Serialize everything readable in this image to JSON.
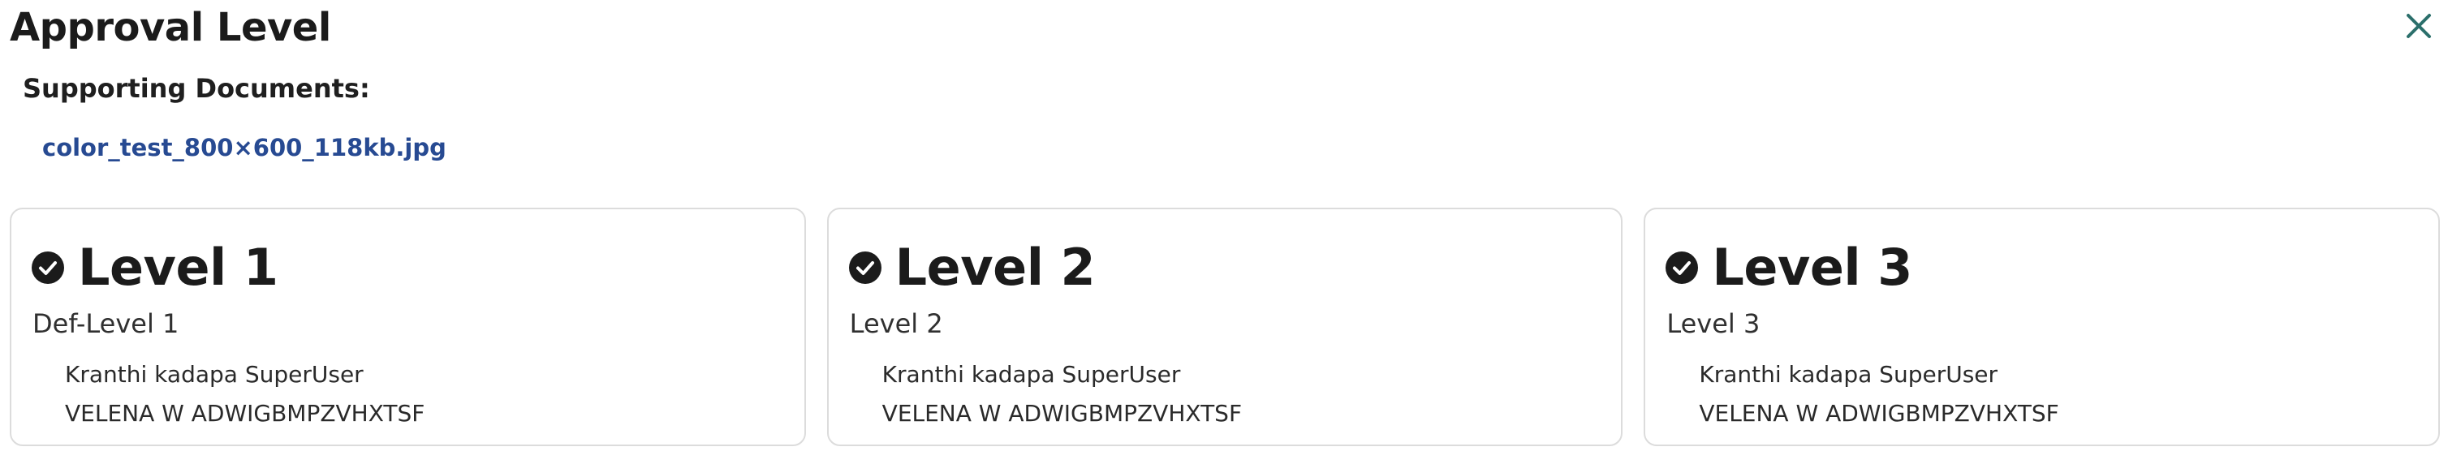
{
  "header": {
    "title": "Approval Level",
    "close_icon": "close-icon"
  },
  "documents": {
    "label": "Supporting Documents:",
    "files": [
      "color_test_800×600_118kb.jpg"
    ]
  },
  "levels": [
    {
      "title": "Level 1",
      "subtitle": "Def-Level 1",
      "status_icon": "check-circle-icon",
      "approvers": [
        "Kranthi kadapa SuperUser",
        "VELENA W ADWIGBMPZVHXTSF"
      ]
    },
    {
      "title": "Level 2",
      "subtitle": "Level 2",
      "status_icon": "check-circle-icon",
      "approvers": [
        "Kranthi kadapa SuperUser",
        "VELENA W ADWIGBMPZVHXTSF"
      ]
    },
    {
      "title": "Level 3",
      "subtitle": "Level 3",
      "status_icon": "check-circle-icon",
      "approvers": [
        "Kranthi kadapa SuperUser",
        "VELENA W ADWIGBMPZVHXTSF"
      ]
    }
  ],
  "colors": {
    "link": "#274a92",
    "close": "#2b6f6b",
    "border": "#dcdcdc"
  }
}
